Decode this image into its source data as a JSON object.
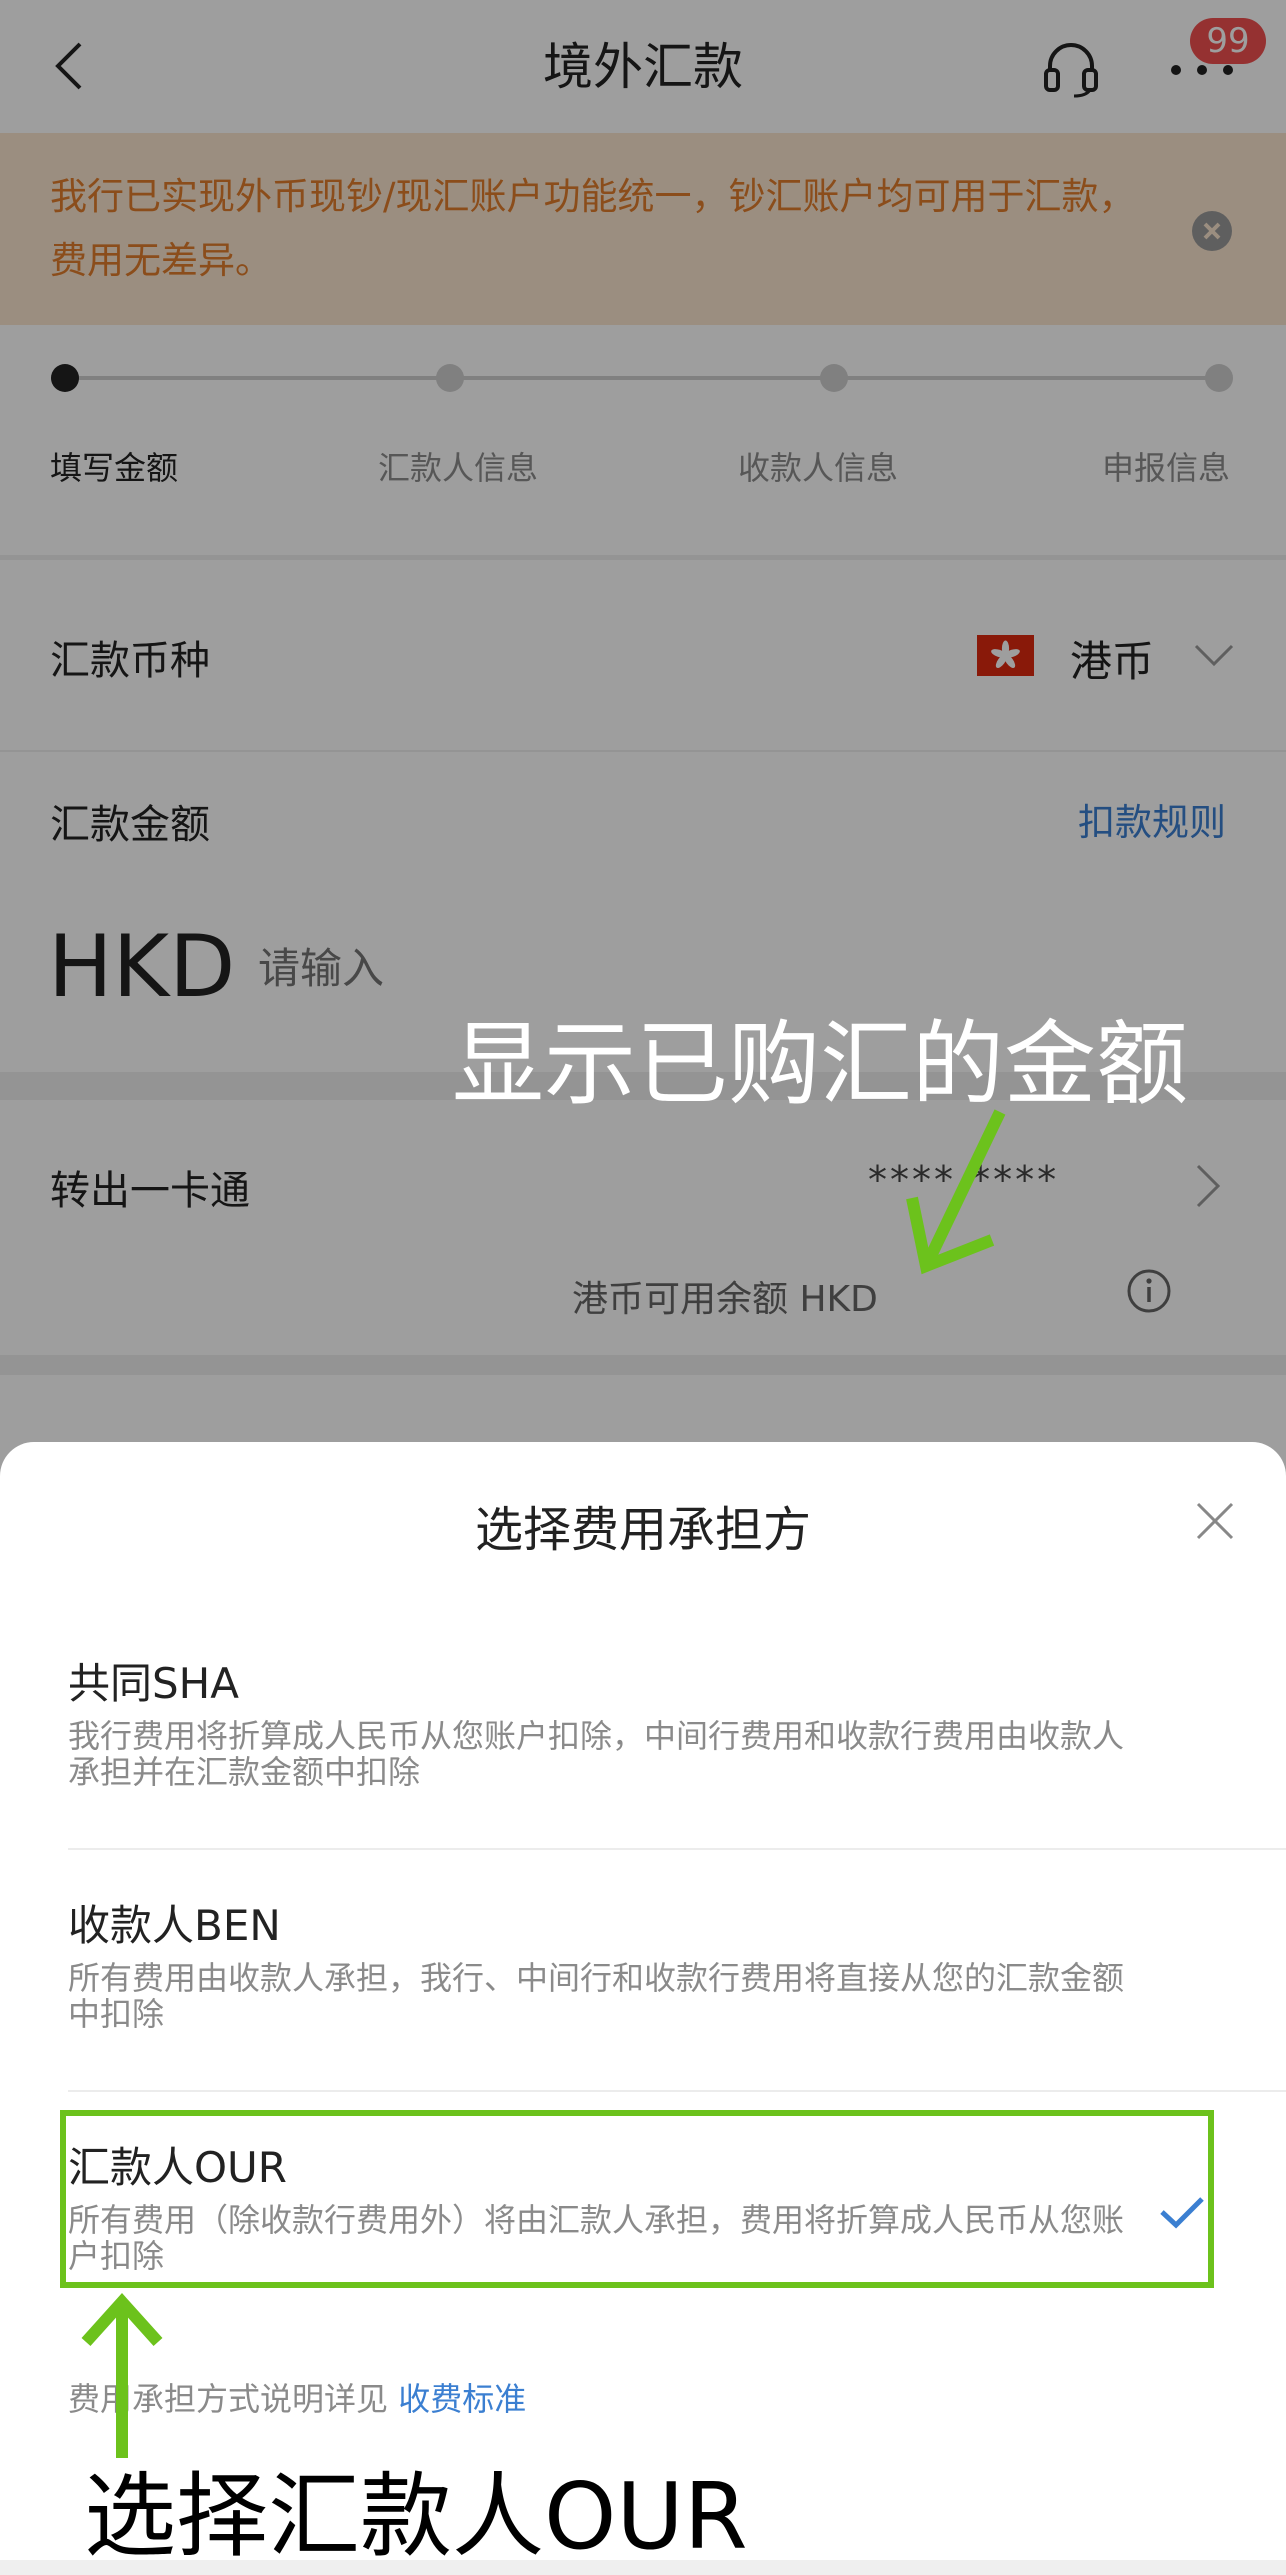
{
  "header": {
    "title": "境外汇款",
    "badge_count": "99"
  },
  "notice": {
    "text": "我行已实现外币现钞/现汇账户功能统一，钞汇账户均可用于汇款，费用无差异。"
  },
  "progress": {
    "steps": [
      "填写金额",
      "汇款人信息",
      "收款人信息",
      "申报信息"
    ],
    "current_step": 0
  },
  "form": {
    "currency_label": "汇款币种",
    "currency_value": "港币",
    "amount_label": "汇款金额",
    "deduction_rule_link": "扣款规则",
    "amount_prefix": "HKD",
    "amount_placeholder": "请输入",
    "card_label": "转出一卡通",
    "card_number": "**** ****",
    "balance_text": "港币可用余额 HKD"
  },
  "annotations": {
    "top": "显示已购汇的金额",
    "bottom": "选择汇款人OUR"
  },
  "sheet": {
    "title": "选择费用承担方",
    "options": [
      {
        "title": "共同SHA",
        "desc": "我行费用将折算成人民币从您账户扣除，中间行费用和收款行费用由收款人承担并在汇款金额中扣除",
        "selected": false
      },
      {
        "title": "收款人BEN",
        "desc": "所有费用由收款人承担，我行、中间行和收款行费用将直接从您的汇款金额中扣除",
        "selected": false
      },
      {
        "title": "汇款人OUR",
        "desc": "所有费用（除收款行费用外）将由汇款人承担，费用将折算成人民币从您账户扣除",
        "selected": true
      }
    ],
    "fee_note": "费用承担方式说明详见",
    "fee_link": "收费标准"
  },
  "colors": {
    "accent_blue": "#3b7fd1",
    "notice_orange": "#e07d2c",
    "highlight_green": "#6cc21c",
    "badge_red": "#f0504f"
  }
}
